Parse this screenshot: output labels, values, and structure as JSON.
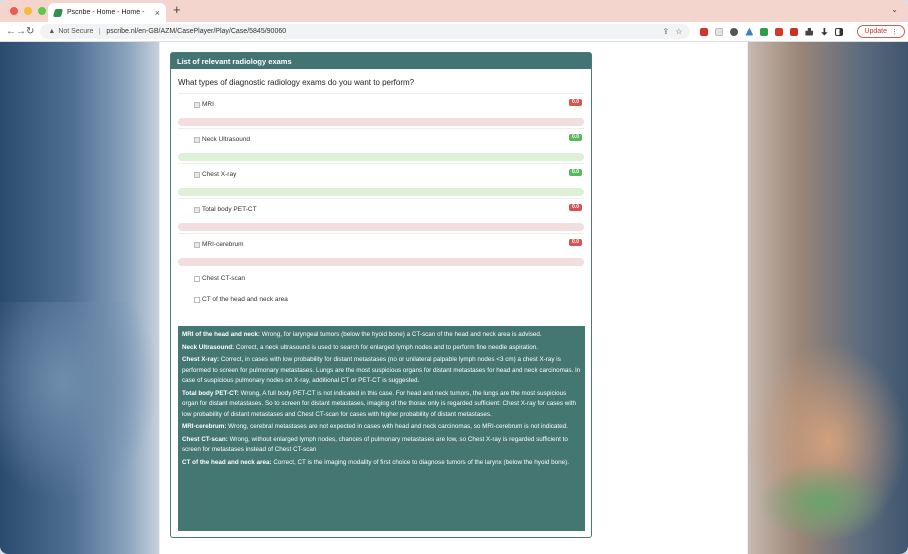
{
  "browser": {
    "tab_title": "Pscribe - Home - Home -",
    "tab_close": "×",
    "new_tab": "+",
    "tab_menu": "⌄",
    "security": "Not Secure",
    "url": "pscribe.nl/en-GB/AZM/CasePlayer/Play/Case/5845/90060",
    "update_label": "Update",
    "back": "←",
    "forward": "→",
    "reload": "↻",
    "menu": "⋮"
  },
  "panel": {
    "title": "List of relevant radiology exams",
    "question": "What types of diagnostic radiology exams do you want to perform?"
  },
  "answered_options": [
    {
      "label": "MRI",
      "score": "0.0",
      "status": "red"
    },
    {
      "label": "Neck Ultrasound",
      "score": "0.0",
      "status": "green"
    },
    {
      "label": "Chest X-ray",
      "score": "0.0",
      "status": "green"
    },
    {
      "label": "Total body PET-CT",
      "score": "0.0",
      "status": "red"
    },
    {
      "label": "MRI-cerebrum",
      "score": "0.0",
      "status": "red"
    }
  ],
  "unanswered_options": [
    {
      "label": "Chest CT-scan"
    },
    {
      "label": "CT of the head and neck area"
    }
  ],
  "feedback": [
    {
      "title": "MRI of the head and neck:",
      "text": " Wrong, for laryngeal tumors (below the hyoid bone) a CT-scan of the head and neck area is advised."
    },
    {
      "title": "Neck Ultrasound:",
      "text": " Correct, a neck ultrasound is used to search for enlarged lymph nodes and to perform fine needle aspiration."
    },
    {
      "title": "Chest X-ray:",
      "text": " Correct, in cases with low probability for distant metastases (no or unilateral palpable lymph nodes <3 cm) a chest X-ray is performed to screen for pulmonary metastases. Lungs are the most suspicious organs for distant metastases for head and neck carcinomas. In case of suspicious pulmonary nodes on X-ray, additional CT or PET-CT is suggested."
    },
    {
      "title": "Total body PET-CT:",
      "text": " Wrong, A full body PET-CT is not indicated in this case. For head and neck tumors, the lungs are the most suspicious organ for distant metastases. So to screen for distant metastases, imaging of the thorax only is regarded sufficient: Chest X-ray for cases with low probability of distant metastases and Chest CT-scan for cases with higher probability of distant metastases."
    },
    {
      "title": "MRI-cerebrum:",
      "text": " Wrong, cerebral metastases are not expected in cases with head and neck carcinomas, so MRI-cerebrum is not indicated."
    },
    {
      "title": "Chest CT-scan:",
      "text": " Wrong, without enlarged lymph nodes, chances of pulmonary metastases are low, so Chest X-ray is regarded sufficient to screen for metastases instead of Chest CT-scan"
    },
    {
      "title": "CT of the head and neck area:",
      "text": " Correct, CT is the imaging modality of first choice to diagnose tumors of the larynx (below the hyoid bone)."
    }
  ]
}
